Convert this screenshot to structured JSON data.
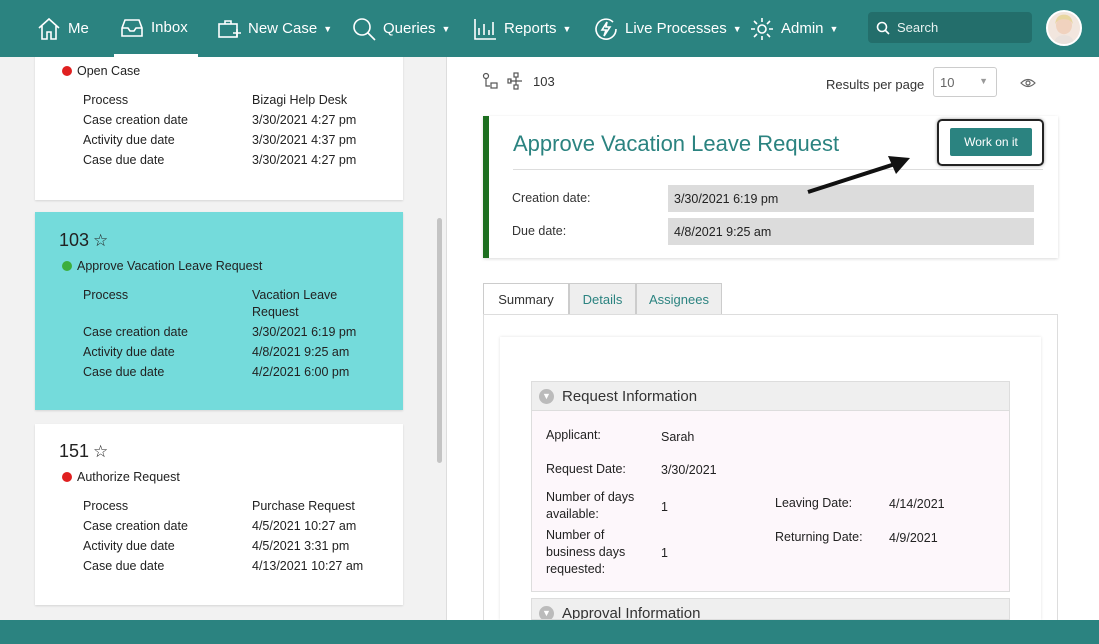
{
  "nav": {
    "me": "Me",
    "inbox": "Inbox",
    "new_case": "New Case",
    "queries": "Queries",
    "reports": "Reports",
    "live_processes": "Live Processes",
    "admin": "Admin",
    "search_placeholder": "Search"
  },
  "case_list": {
    "cards": [
      {
        "number": "",
        "status": "Open Case",
        "status_color": "#e02020",
        "rows": [
          {
            "label": "Process",
            "value": "Bizagi Help Desk"
          },
          {
            "label": "Case creation date",
            "value": "3/30/2021 4:27 pm"
          },
          {
            "label": "Activity due date",
            "value": "3/30/2021 4:37 pm"
          },
          {
            "label": "Case due date",
            "value": "3/30/2021 4:27 pm"
          }
        ]
      },
      {
        "number": "103",
        "status": "Approve Vacation Leave Request",
        "status_color": "#3cae3c",
        "rows": [
          {
            "label": "Process",
            "value": "Vacation Leave Request"
          },
          {
            "label": "Case creation date",
            "value": "3/30/2021 6:19 pm"
          },
          {
            "label": "Activity due date",
            "value": "4/8/2021 9:25 am"
          },
          {
            "label": "Case due date",
            "value": "4/2/2021 6:00 pm"
          }
        ]
      },
      {
        "number": "151",
        "status": "Authorize Request",
        "status_color": "#e02020",
        "rows": [
          {
            "label": "Process",
            "value": "Purchase Request"
          },
          {
            "label": "Case creation date",
            "value": "4/5/2021 10:27 am"
          },
          {
            "label": "Activity due date",
            "value": "4/5/2021 3:31 pm"
          },
          {
            "label": "Case due date",
            "value": "4/13/2021 10:27 am"
          }
        ]
      }
    ]
  },
  "detail": {
    "case_number": "103",
    "results_per_page_label": "Results per page",
    "results_per_page_value": "10",
    "activity_title": "Approve Vacation Leave Request",
    "work_on_it": "Work on it",
    "creation_date_label": "Creation date:",
    "creation_date_value": "3/30/2021 6:19 pm",
    "due_date_label": "Due date:",
    "due_date_value": "4/8/2021 9:25 am",
    "tabs": [
      "Summary",
      "Details",
      "Assignees"
    ],
    "request_info": {
      "title": "Request Information",
      "applicant_label": "Applicant:",
      "applicant_value": "Sarah",
      "request_date_label": "Request Date:",
      "request_date_value": "3/30/2021",
      "days_available_label": "Number of days available:",
      "days_available_value": "1",
      "business_days_label": "Number of business days requested:",
      "business_days_value": "1",
      "leaving_date_label": "Leaving Date:",
      "leaving_date_value": "4/14/2021",
      "returning_date_label": "Returning Date:",
      "returning_date_value": "4/9/2021"
    },
    "approval_info_title": "Approval Information"
  }
}
